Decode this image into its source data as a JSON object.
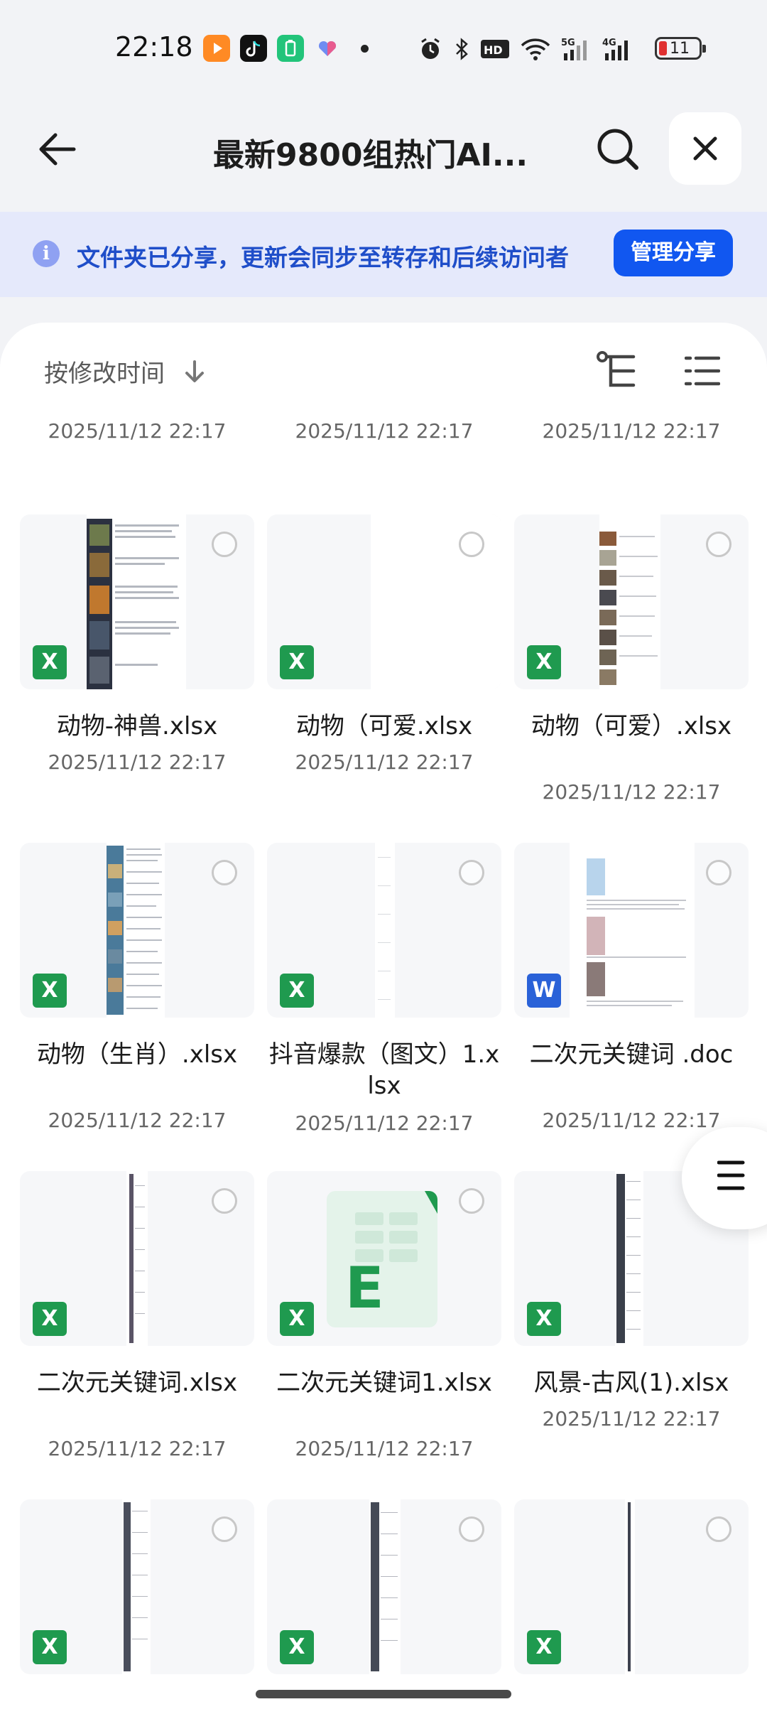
{
  "status_bar": {
    "time": "22:18",
    "battery": "11"
  },
  "header": {
    "title": "最新9800组热门AI..."
  },
  "banner": {
    "message": "文件夹已分享，更新会同步至转存和后续访问者",
    "manage_label": "管理分享"
  },
  "sort": {
    "label": "按修改时间"
  },
  "top_row_dates": [
    "2025/11/12 22:17",
    "2025/11/12 22:17",
    "2025/11/12 22:17"
  ],
  "files": [
    {
      "name": "动物-神兽.xlsx",
      "date": "2025/11/12 22:17",
      "type": "X"
    },
    {
      "name": "动物（可爱.xlsx",
      "date": "2025/11/12 22:17",
      "type": "X"
    },
    {
      "name": "动物（可爱）.xlsx",
      "date": "2025/11/12 22:17",
      "type": "X"
    },
    {
      "name": "动物（生肖）.xlsx",
      "date": "2025/11/12 22:17",
      "type": "X"
    },
    {
      "name": "抖音爆款（图文）1.xlsx",
      "date": "2025/11/12 22:17",
      "type": "X"
    },
    {
      "name": "二次元关键词 .doc",
      "date": "2025/11/12 22:17",
      "type": "W"
    },
    {
      "name": "二次元关键词.xlsx",
      "date": "2025/11/12 22:17",
      "type": "X"
    },
    {
      "name": "二次元关键词1.xlsx",
      "date": "2025/11/12 22:17",
      "type": "X"
    },
    {
      "name": "风景-古风(1).xlsx",
      "date": "2025/11/12 22:17",
      "type": "X"
    },
    {
      "name": "",
      "date": "",
      "type": "X"
    },
    {
      "name": "",
      "date": "",
      "type": "X"
    },
    {
      "name": "",
      "date": "",
      "type": "X"
    }
  ],
  "icons": {
    "back": "arrow-left-icon",
    "search": "search-icon",
    "close": "close-icon",
    "info": "info-icon",
    "sort_arrow": "arrow-down-icon",
    "tree_view": "tree-view-icon",
    "list_view": "list-view-icon",
    "menu": "menu-icon",
    "excel_large": "excel-icon"
  },
  "colors": {
    "accent": "#1157f0",
    "banner_bg": "#e5e9fb",
    "excel": "#1f9a4f",
    "word": "#2a62d8"
  }
}
